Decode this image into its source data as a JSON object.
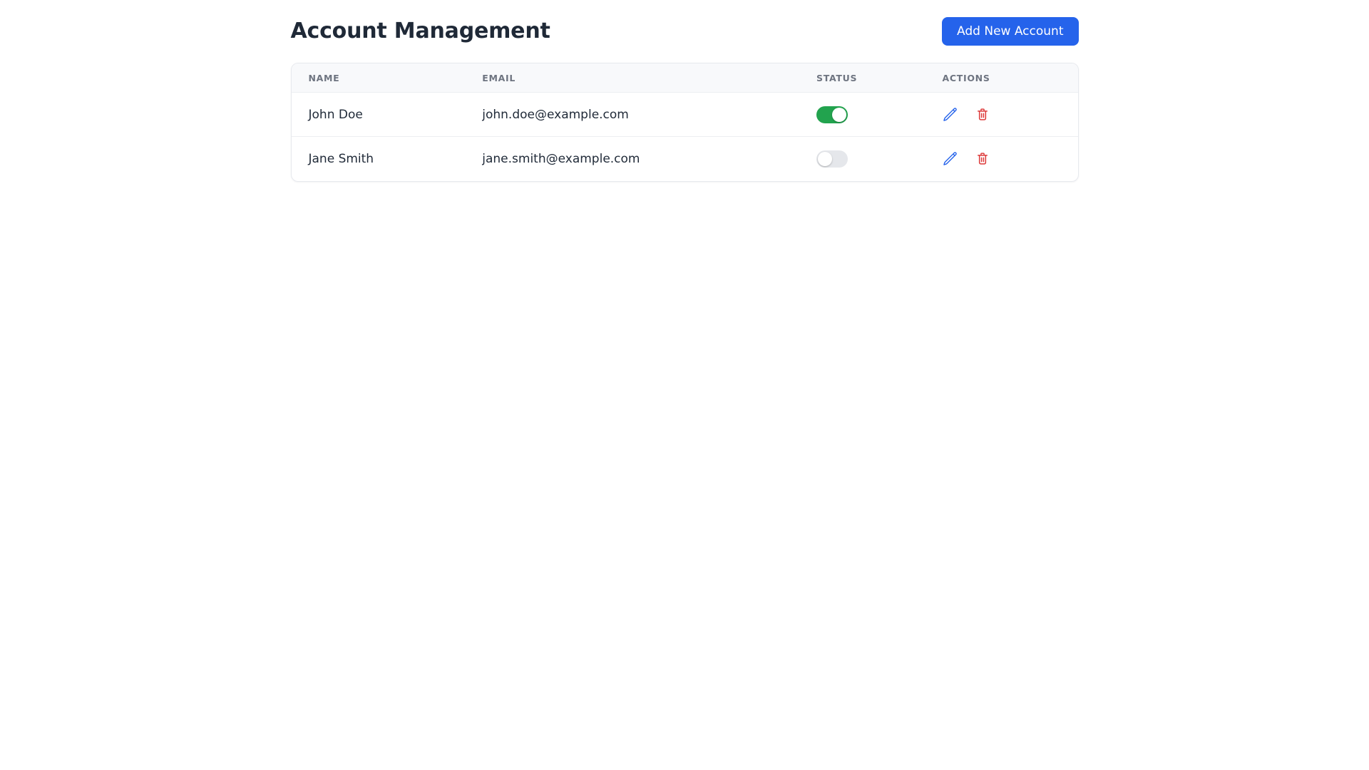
{
  "page": {
    "title": "Account Management"
  },
  "toolbar": {
    "add_button_label": "Add New Account"
  },
  "table": {
    "columns": {
      "name": "Name",
      "email": "Email",
      "status": "Status",
      "actions": "Actions"
    },
    "rows": [
      {
        "name": "John Doe",
        "email": "john.doe@example.com",
        "status": "on"
      },
      {
        "name": "Jane Smith",
        "email": "jane.smith@example.com",
        "status": "off"
      }
    ]
  },
  "icons": {
    "edit": "pencil-icon",
    "delete": "trash-icon"
  },
  "colors": {
    "accent_blue": "#2563eb",
    "toggle_on_green": "#22a34e",
    "toggle_off_gray": "#e5e7eb",
    "delete_red": "#dd3b3b",
    "header_text_gray": "#6e7480",
    "body_text_dark": "#1f2937",
    "table_header_bg": "#f8f9fb",
    "card_border": "#e7e9ee"
  }
}
